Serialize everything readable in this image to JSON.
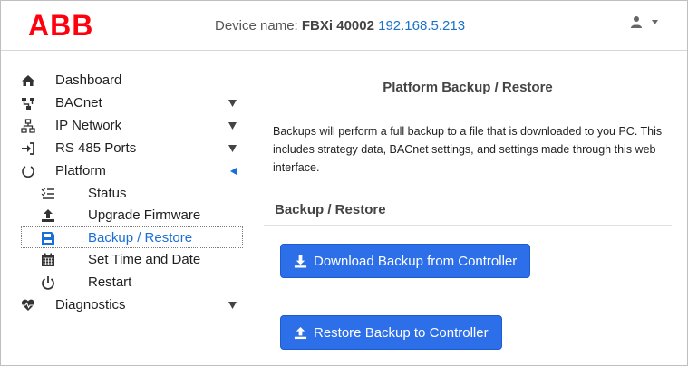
{
  "header": {
    "logo_text": "ABB",
    "device_label": "Device name:",
    "device_name": "FBXi 40002",
    "device_ip": "192.168.5.213",
    "user_icon": "user-icon",
    "menu_caret": "caret-down-icon"
  },
  "sidebar": {
    "items": [
      {
        "label": "Dashboard",
        "icon": "home-icon",
        "caret": ""
      },
      {
        "label": "BACnet",
        "icon": "network-tree-icon",
        "caret": "down"
      },
      {
        "label": "IP Network",
        "icon": "lan-icon",
        "caret": "down"
      },
      {
        "label": "RS 485 Ports",
        "icon": "sign-in-icon",
        "caret": "down"
      },
      {
        "label": "Platform",
        "icon": "circle-notch-icon",
        "caret": "left"
      },
      {
        "label": "Diagnostics",
        "icon": "heartbeat-icon",
        "caret": "down"
      }
    ],
    "platform_sub": [
      {
        "label": "Status",
        "icon": "list-check-icon"
      },
      {
        "label": "Upgrade Firmware",
        "icon": "upload-icon"
      },
      {
        "label": "Backup / Restore",
        "icon": "save-icon",
        "active": true
      },
      {
        "label": "Set Time and Date",
        "icon": "calendar-icon"
      },
      {
        "label": "Restart",
        "icon": "power-icon"
      }
    ]
  },
  "main": {
    "title": "Platform Backup / Restore",
    "description": "Backups will perform a full backup to a file that is downloaded to you PC. This includes strategy data, BACnet settings, and settings made through this web interface.",
    "subtitle": "Backup / Restore",
    "download_button": "Download Backup from Controller",
    "restore_button": "Restore Backup to Controller"
  },
  "colors": {
    "brand_red": "#ff000f",
    "accent_blue": "#2c6fe8",
    "link_blue": "#1a73c8"
  }
}
